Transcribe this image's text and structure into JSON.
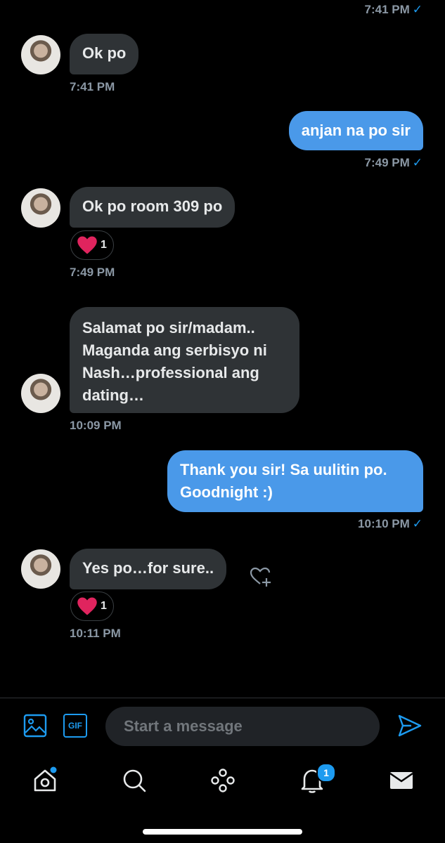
{
  "messages": {
    "top_timestamp": "7:41 PM",
    "m1": {
      "text": "Ok po",
      "time": "7:41 PM"
    },
    "m2": {
      "text": "anjan na po sir",
      "time": "7:49 PM"
    },
    "m3": {
      "text": "Ok po room 309 po",
      "time": "7:49 PM",
      "reaction_count": "1"
    },
    "m4": {
      "text": "Salamat po sir/madam.. Maganda ang serbisyo ni Nash…professional ang dating…",
      "time": "10:09 PM"
    },
    "m5": {
      "text": "Thank you sir! Sa uulitin po. Goodnight :)",
      "time": "10:10 PM"
    },
    "m6": {
      "text": "Yes po…for sure..",
      "time": "10:11 PM",
      "reaction_count": "1"
    }
  },
  "composer": {
    "placeholder": "Start a message",
    "gif_label": "GIF"
  },
  "nav": {
    "notifications_badge": "1"
  },
  "colors": {
    "accent": "#1d9bf0",
    "outgoing_bubble": "#4a99e9",
    "incoming_bubble": "#2f3336",
    "heart": "#e0245e"
  },
  "icons": [
    "image-icon",
    "gif-icon",
    "send-icon",
    "home-icon",
    "search-icon",
    "spaces-icon",
    "bell-icon",
    "mail-icon",
    "add-reaction-icon",
    "heart-icon"
  ]
}
